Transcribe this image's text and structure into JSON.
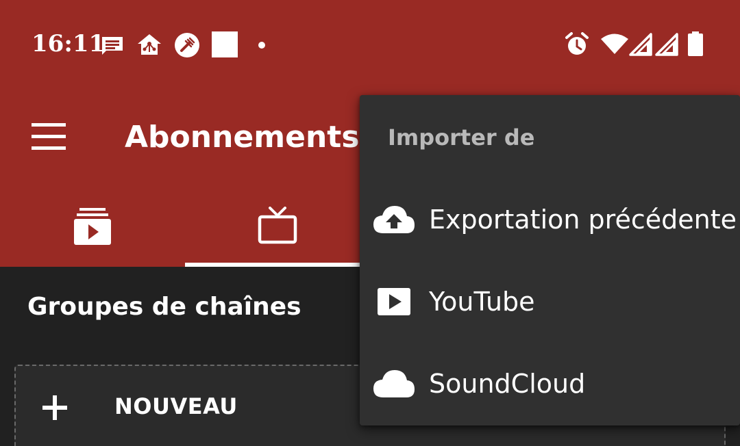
{
  "status_bar": {
    "time": "16:11",
    "left_icons": [
      "message-icon",
      "home-network-icon",
      "tool-icon",
      "square-icon",
      "dot-icon"
    ],
    "right_icons": [
      "alarm-icon",
      "wifi-icon",
      "signal-icon",
      "signal-icon",
      "battery-icon"
    ]
  },
  "toolbar": {
    "menu_icon": "hamburger-menu-icon",
    "title": "Abonnements"
  },
  "tabs": [
    {
      "icon": "feed-icon",
      "selected": false
    },
    {
      "icon": "tv-icon",
      "selected": true
    }
  ],
  "content": {
    "section_title": "Groupes de chaînes",
    "new_group": {
      "icon": "plus-icon",
      "label": "NOUVEAU"
    }
  },
  "import_menu": {
    "header": "Importer de",
    "items": [
      {
        "icon": "cloud-upload-icon",
        "label": "Exportation précédente"
      },
      {
        "icon": "youtube-icon",
        "label": "YouTube"
      },
      {
        "icon": "soundcloud-icon",
        "label": "SoundCloud"
      }
    ]
  },
  "colors": {
    "primary": "#992A24",
    "background": "#212121",
    "popup": "#303030",
    "text": "#FFFFFF",
    "muted_text": "#B9B9B9"
  }
}
